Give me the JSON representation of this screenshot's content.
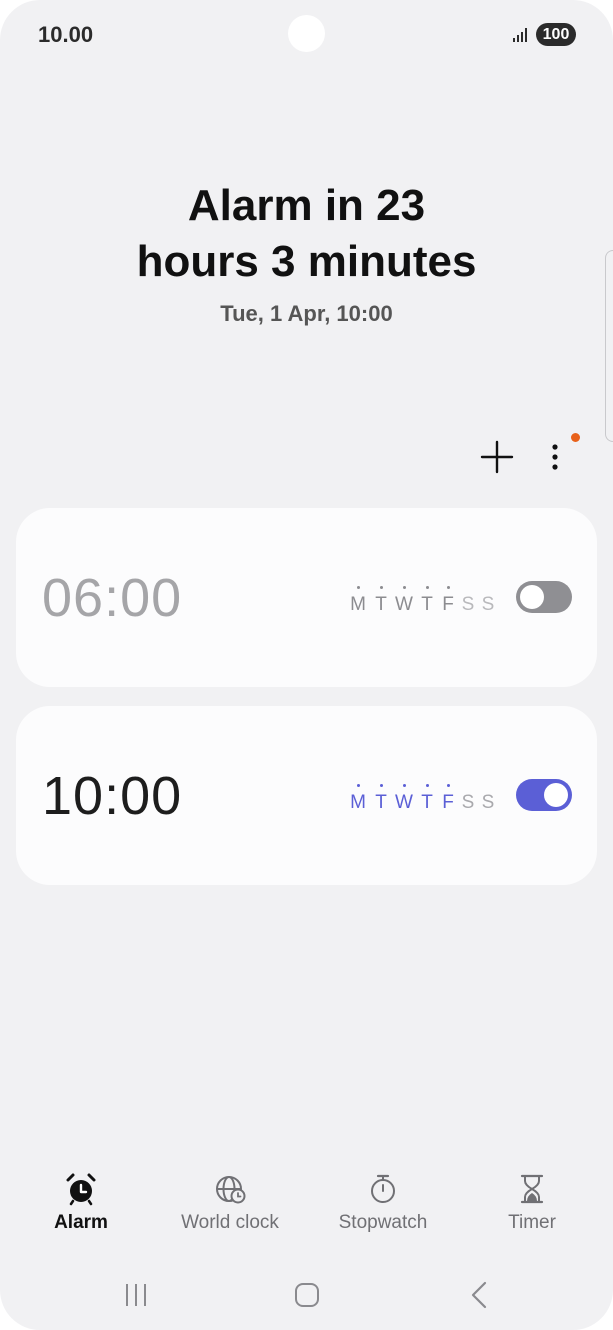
{
  "status_bar": {
    "time": "10.00",
    "battery": "100"
  },
  "header": {
    "line1": "Alarm in 23",
    "line2": "hours 3 minutes",
    "next_alarm": "Tue, 1 Apr, 10:00"
  },
  "actions": {
    "add_icon": "plus-icon",
    "more_icon": "more-vertical-icon",
    "badge_color": "#e8611a"
  },
  "alarms": [
    {
      "time": "06:00",
      "enabled": false,
      "days": [
        {
          "letter": "M",
          "active": true
        },
        {
          "letter": "T",
          "active": true
        },
        {
          "letter": "W",
          "active": true
        },
        {
          "letter": "T",
          "active": true
        },
        {
          "letter": "F",
          "active": true
        },
        {
          "letter": "S",
          "active": false
        },
        {
          "letter": "S",
          "active": false
        }
      ]
    },
    {
      "time": "10:00",
      "enabled": true,
      "days": [
        {
          "letter": "M",
          "active": true
        },
        {
          "letter": "T",
          "active": true
        },
        {
          "letter": "W",
          "active": true
        },
        {
          "letter": "T",
          "active": true
        },
        {
          "letter": "F",
          "active": true
        },
        {
          "letter": "S",
          "active": false
        },
        {
          "letter": "S",
          "active": false
        }
      ]
    }
  ],
  "bottom_nav": {
    "items": [
      {
        "label": "Alarm",
        "icon": "alarm-clock-icon",
        "active": true
      },
      {
        "label": "World clock",
        "icon": "globe-clock-icon",
        "active": false
      },
      {
        "label": "Stopwatch",
        "icon": "stopwatch-icon",
        "active": false
      },
      {
        "label": "Timer",
        "icon": "hourglass-icon",
        "active": false
      }
    ]
  },
  "system_nav": {
    "recent": "recent-apps-icon",
    "home": "home-icon",
    "back": "back-icon"
  },
  "colors": {
    "accent": "#5b5fd6",
    "background": "#f1f1f3",
    "card": "#fcfcfd",
    "toggle_off": "#8f8f93"
  }
}
